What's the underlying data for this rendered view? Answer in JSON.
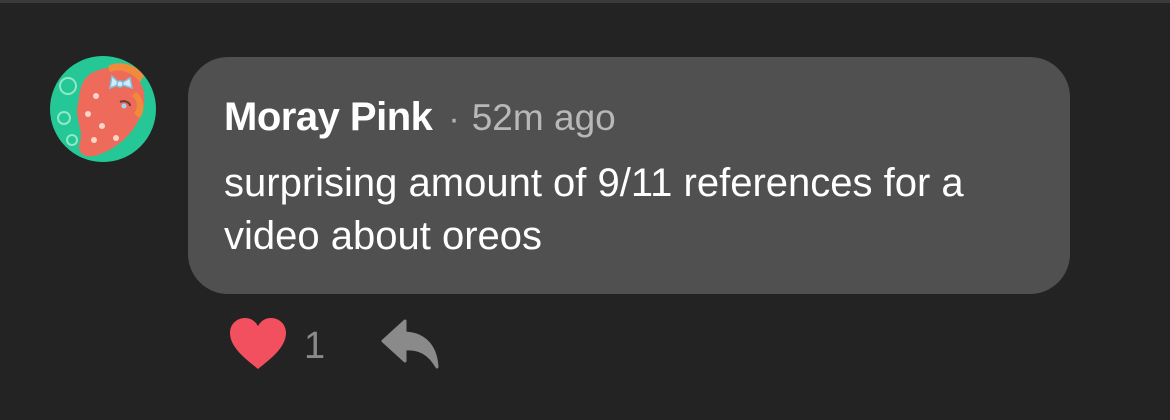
{
  "comment": {
    "author": "Moray Pink",
    "separator": "·",
    "timestamp": "52m ago",
    "text": "surprising amount of 9/11 references for a video about oreos",
    "likes": "1"
  },
  "icons": {
    "like": "heart-icon",
    "reply": "reply-arrow-icon"
  },
  "colors": {
    "background": "#232323",
    "bubble": "#505050",
    "heart": "#f2505e",
    "reply_icon": "#8a8a8a",
    "avatar_bg": "#25c796"
  }
}
